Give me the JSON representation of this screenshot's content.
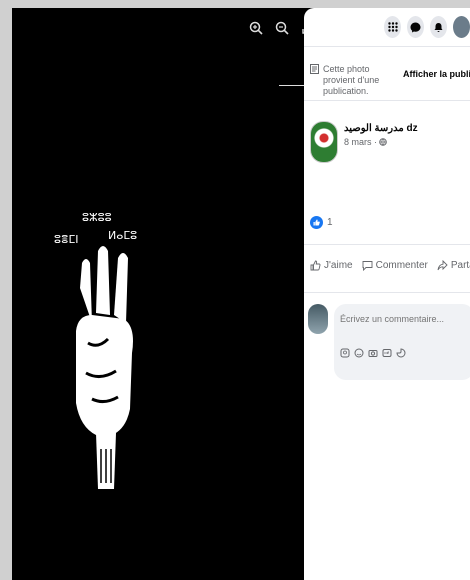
{
  "viewer": {
    "tools": [
      "zoom-in-icon",
      "zoom-out-icon",
      "fullscreen-icon"
    ],
    "photo_text": {
      "top": "ⵓⵣⵓⵓ",
      "left": "ⵓⴻⵎⵏ",
      "right": "ⵍⴰⵎⵓ"
    }
  },
  "topbar": {
    "buttons": [
      "grid-icon",
      "messenger-icon",
      "bell-icon",
      "profile-avatar"
    ]
  },
  "origin": {
    "note": "Cette photo provient d'une publication.",
    "view_post": "Afficher la publica"
  },
  "post": {
    "author": "مدرسة الوصيد dz",
    "date": "8 mars · ",
    "reaction_count": "1"
  },
  "actions": {
    "like": "J'aime",
    "comment": "Commenter",
    "share": "Parta"
  },
  "comment": {
    "placeholder": "Écrivez un commentaire..."
  },
  "colors": {
    "accent": "#1877f2",
    "panel_bg": "#ffffff",
    "viewer_bg": "#000000"
  }
}
